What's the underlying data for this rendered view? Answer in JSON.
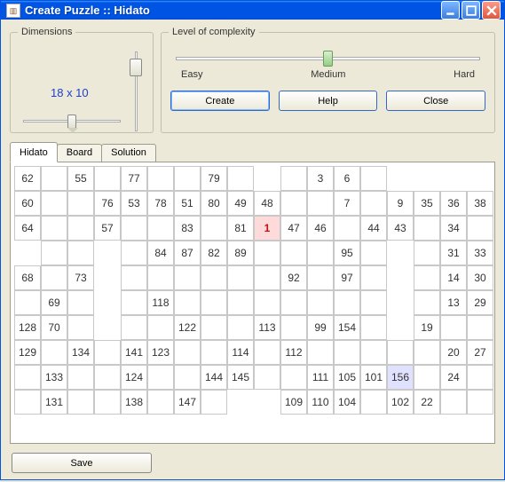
{
  "window": {
    "title": "Create Puzzle :: Hidato"
  },
  "dimensions": {
    "legend": "Dimensions",
    "value": "18 x 10"
  },
  "complexity": {
    "legend": "Level of complexity",
    "easy": "Easy",
    "medium": "Medium",
    "hard": "Hard"
  },
  "buttons": {
    "create": "Create",
    "help": "Help",
    "close": "Close",
    "save": "Save"
  },
  "tabs": {
    "hidato": "Hidato",
    "board": "Board",
    "solution": "Solution"
  },
  "grid": {
    "cols": 18,
    "rows": 11,
    "cells": [
      [
        [
          "62"
        ],
        [
          ""
        ],
        [
          "55"
        ],
        [
          ""
        ],
        [
          "77"
        ],
        [
          ""
        ],
        [
          ""
        ],
        [
          "79"
        ],
        [
          ""
        ],
        null,
        [
          ""
        ],
        [
          "3"
        ],
        [
          "6"
        ],
        [
          ""
        ],
        null,
        null,
        null,
        null
      ],
      [
        [
          "60"
        ],
        [
          ""
        ],
        [
          ""
        ],
        [
          "76"
        ],
        [
          "53"
        ],
        [
          "78"
        ],
        [
          "51"
        ],
        [
          "80"
        ],
        [
          "49"
        ],
        [
          "48"
        ],
        [
          ""
        ],
        [
          ""
        ],
        [
          "7"
        ],
        [
          ""
        ],
        [
          "9"
        ],
        [
          "35"
        ],
        [
          "36"
        ],
        [
          "38"
        ]
      ],
      [
        [
          "64"
        ],
        [
          ""
        ],
        [
          ""
        ],
        [
          "57"
        ],
        [
          ""
        ],
        [
          ""
        ],
        [
          "83"
        ],
        [
          ""
        ],
        [
          "81"
        ],
        [
          "1",
          "start"
        ],
        [
          "47"
        ],
        [
          "46"
        ],
        [
          ""
        ],
        [
          "44"
        ],
        [
          "43"
        ],
        [
          ""
        ],
        [
          "34"
        ],
        [
          ""
        ]
      ],
      [
        null,
        [
          ""
        ],
        [
          ""
        ],
        null,
        [
          ""
        ],
        [
          "84"
        ],
        [
          "87"
        ],
        [
          "82"
        ],
        [
          "89"
        ],
        [
          ""
        ],
        [
          ""
        ],
        [
          ""
        ],
        [
          "95"
        ],
        [
          ""
        ],
        null,
        [
          ""
        ],
        [
          "31"
        ],
        [
          "33"
        ]
      ],
      [
        [
          "68"
        ],
        [
          ""
        ],
        [
          "73"
        ],
        null,
        [
          ""
        ],
        [
          ""
        ],
        [
          ""
        ],
        [
          ""
        ],
        [
          ""
        ],
        [
          ""
        ],
        [
          "92"
        ],
        [
          ""
        ],
        [
          "97"
        ],
        [
          ""
        ],
        null,
        [
          ""
        ],
        [
          "14"
        ],
        [
          "30"
        ]
      ],
      [
        [
          ""
        ],
        [
          "69"
        ],
        [
          ""
        ],
        null,
        [
          ""
        ],
        [
          "118"
        ],
        [
          ""
        ],
        [
          ""
        ],
        [
          ""
        ],
        [
          ""
        ],
        [
          ""
        ],
        [
          ""
        ],
        [
          ""
        ],
        [
          ""
        ],
        null,
        [
          ""
        ],
        [
          "13"
        ],
        [
          "29"
        ]
      ],
      [
        [
          "128"
        ],
        [
          "70"
        ],
        [
          ""
        ],
        null,
        [
          ""
        ],
        [
          ""
        ],
        [
          "122"
        ],
        [
          ""
        ],
        [
          ""
        ],
        [
          "113"
        ],
        [
          ""
        ],
        [
          "99"
        ],
        [
          "154"
        ],
        [
          ""
        ],
        null,
        [
          "19"
        ],
        [
          ""
        ],
        [
          ""
        ]
      ],
      [
        [
          "129"
        ],
        [
          ""
        ],
        [
          "134"
        ],
        [
          ""
        ],
        [
          "141"
        ],
        [
          "123"
        ],
        [
          ""
        ],
        [
          ""
        ],
        [
          "114"
        ],
        [
          ""
        ],
        [
          "112"
        ],
        [
          ""
        ],
        [
          ""
        ],
        [
          ""
        ],
        [
          ""
        ],
        [
          ""
        ],
        [
          "20"
        ],
        [
          "27"
        ]
      ],
      [
        [
          ""
        ],
        [
          "133"
        ],
        [
          ""
        ],
        [
          ""
        ],
        [
          "124"
        ],
        [
          ""
        ],
        [
          ""
        ],
        [
          "144"
        ],
        [
          "145"
        ],
        [
          ""
        ],
        [
          ""
        ],
        [
          "111"
        ],
        [
          "105"
        ],
        [
          "101"
        ],
        [
          "156",
          "end"
        ],
        [
          ""
        ],
        [
          "24"
        ],
        [
          ""
        ]
      ],
      [
        [
          ""
        ],
        [
          "131"
        ],
        [
          ""
        ],
        [
          ""
        ],
        [
          "138"
        ],
        [
          ""
        ],
        [
          "147"
        ],
        [
          ""
        ],
        null,
        null,
        [
          "109"
        ],
        [
          "110"
        ],
        [
          "104"
        ],
        [
          ""
        ],
        [
          "102"
        ],
        [
          "22"
        ],
        [
          ""
        ],
        [
          ""
        ]
      ],
      [
        null,
        null,
        null,
        null,
        null,
        null,
        null,
        null,
        null,
        null,
        null,
        null,
        null,
        null,
        null,
        null,
        null,
        null
      ]
    ]
  }
}
